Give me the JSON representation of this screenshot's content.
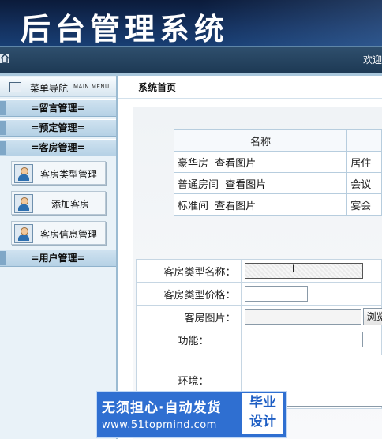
{
  "header": {
    "title": "后台管理系统",
    "welcome": "欢迎"
  },
  "sidebar": {
    "menu_title": "菜单导航",
    "menu_subtitle": "MAIN MENU",
    "groups": [
      {
        "label": "=留言管理="
      },
      {
        "label": "=预定管理="
      },
      {
        "label": "=客房管理="
      },
      {
        "label": "=用户管理="
      }
    ],
    "room_items": [
      {
        "label": "客房类型管理"
      },
      {
        "label": "添加客房"
      },
      {
        "label": "客房信息管理"
      }
    ]
  },
  "main": {
    "breadcrumb": "系统首页",
    "room_table": {
      "headers": [
        "名称",
        ""
      ],
      "rows": [
        {
          "name": "豪华房",
          "link": "查看图片",
          "extra": "居住"
        },
        {
          "name": "普通房间",
          "link": "查看图片",
          "extra": "会议"
        },
        {
          "name": "标准间",
          "link": "查看图片",
          "extra": "宴会"
        }
      ]
    },
    "form": {
      "type_name_label": "客房类型名称：",
      "price_label": "客房类型价格：",
      "image_label": "客房图片：",
      "browse_label": "浏览",
      "function_label": "功能：",
      "environment_label": "环境："
    }
  },
  "watermark": {
    "line1": "无须担心·自动发货",
    "line2": "www.51topmind.com",
    "badge1": "毕业",
    "badge2": "设计"
  },
  "colors": {
    "header_dark": "#0b1b3a",
    "sidebar_group": "#b5d1e5",
    "watermark_blue": "#2f6fd1"
  }
}
